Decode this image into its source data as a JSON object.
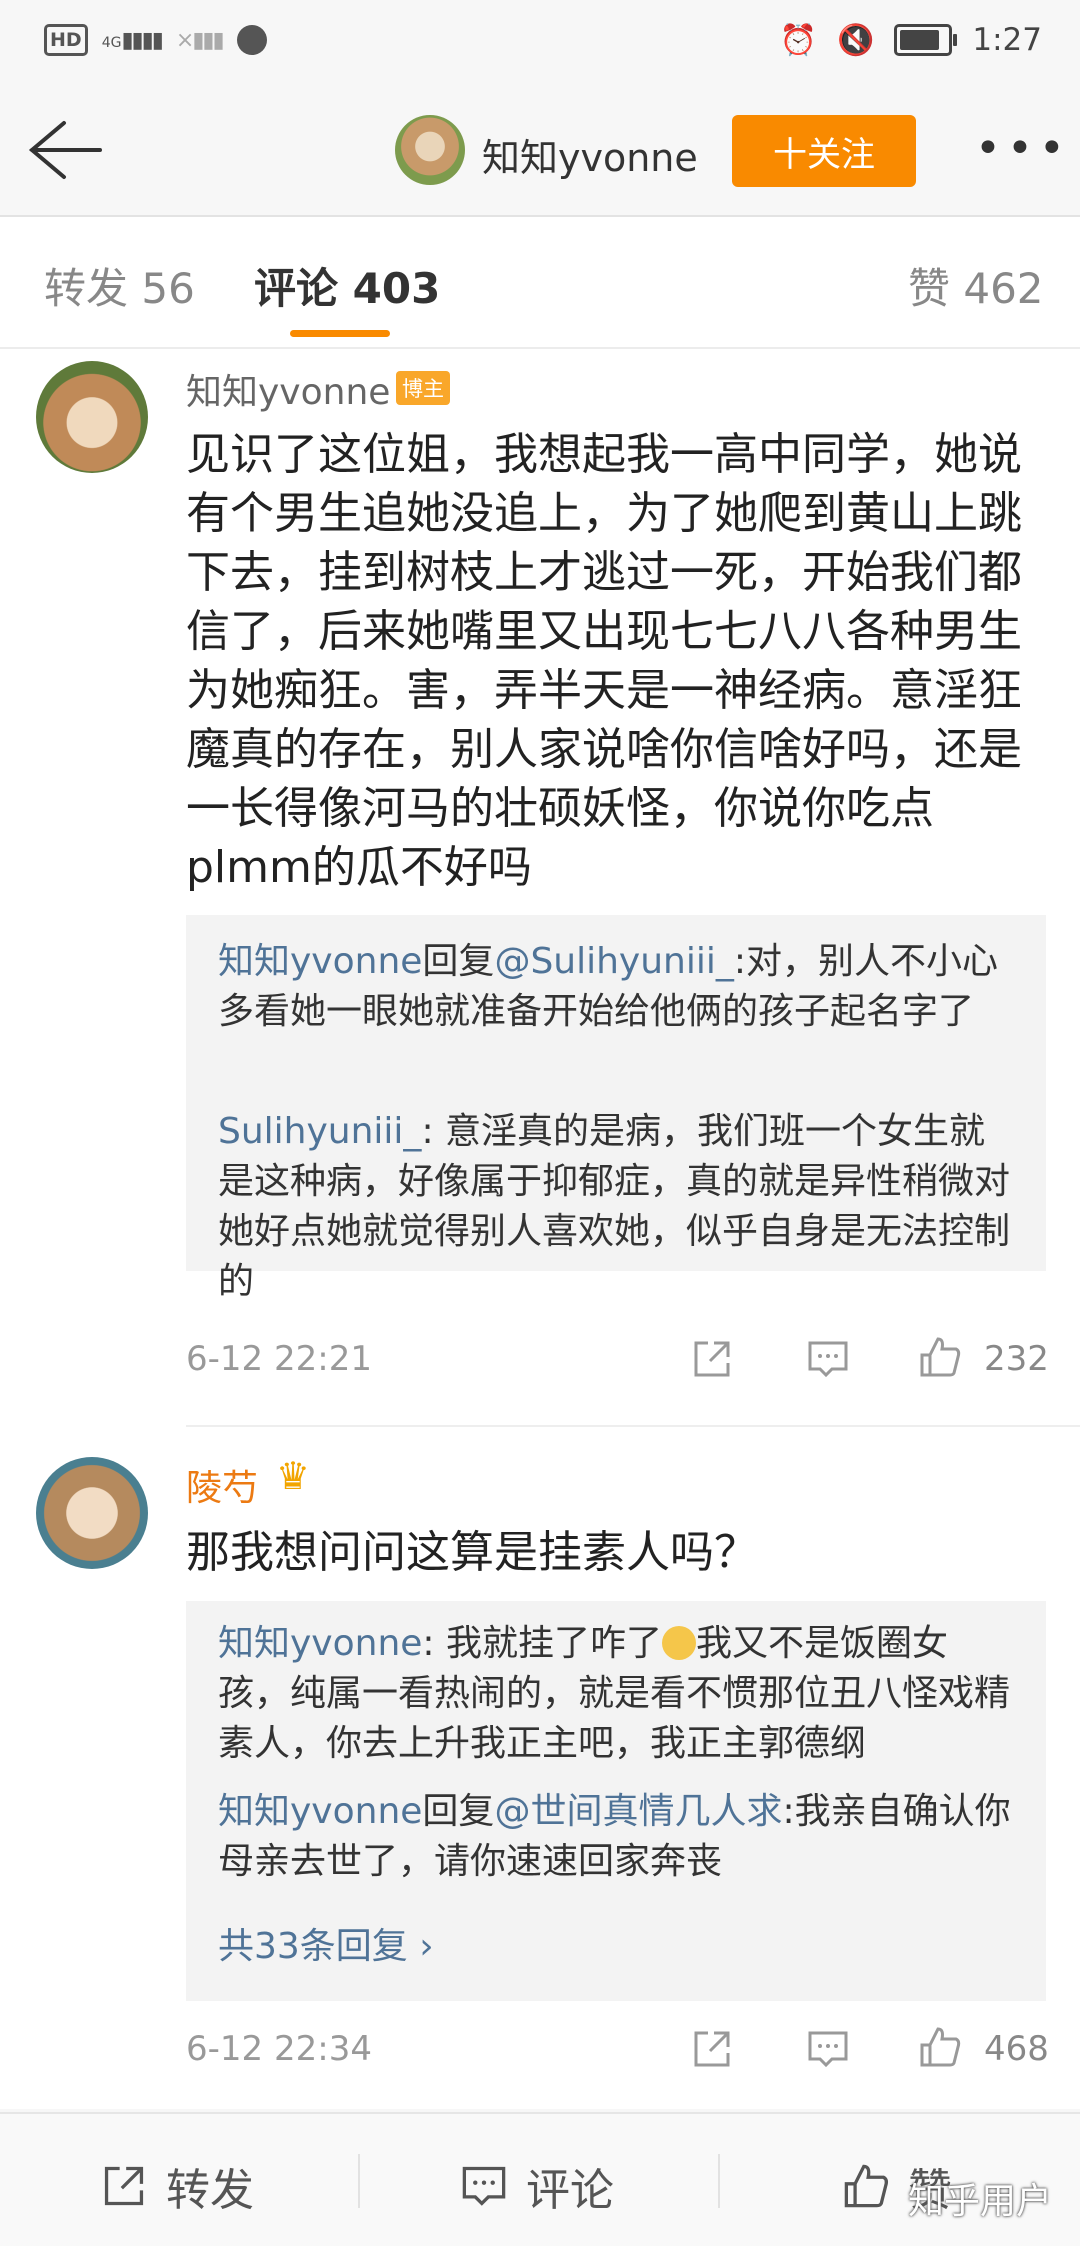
{
  "status_bar": {
    "network": "HD",
    "signal_label": "4G",
    "time": "1:27",
    "battery_level": 0.85
  },
  "nav": {
    "user_name": "知知yvonne",
    "follow_label": "十关注",
    "more_label": "•••"
  },
  "tabs": [
    {
      "label": "转发 56"
    },
    {
      "label": "评论 403"
    },
    {
      "label": "赞 462"
    }
  ],
  "comments": [
    {
      "author": "知知yvonne",
      "badge": "博主",
      "text": "见识了这位姐，我想起我一高中同学，她说有个男生追她没追上，为了她爬到黄山上跳下去，挂到树枝上才逃过一死，开始我们都信了，后来她嘴里又出现七七八八各种男生为她痴狂。害，弄半天是一神经病。意淫狂魔真的存在，别人家说啥你信啥好吗，还是一长得像河马的壮硕妖怪，你说你吃点plmm的瓜不好吗",
      "replies": [
        {
          "user": "知知yvonne",
          "reply_word": "回复",
          "mention": "@Sulihyuniii_",
          "text": ":对，别人不小心多看她一眼她就准备开始给他俩的孩子起名字了"
        },
        {
          "user": "Sulihyuniii_",
          "text": ": 意淫真的是病，我们班一个女生就是这种病，好像属于抑郁症，真的就是异性稍微对她好点她就觉得别人喜欢她，似乎自身是无法控制的"
        }
      ],
      "time": "6-12 22:21",
      "likes": "232"
    },
    {
      "author": "陵芍",
      "text": "那我想问问这算是挂素人吗？",
      "replies": [
        {
          "user": "知知yvonne",
          "text_a": ": 我就挂了咋了",
          "text_b": "我又不是饭圈女孩，纯属一看热闹的，就是看不惯那位丑八怪戏精素人，你去上升我正主吧，我正主郭德纲"
        },
        {
          "user": "知知yvonne",
          "reply_word": "回复",
          "mention": "@世间真情几人求",
          "text": ":我亲自确认你母亲去世了，请你速速回家奔丧"
        }
      ],
      "more_replies": "共33条回复 ›",
      "time": "6-12 22:34",
      "likes": "468"
    }
  ],
  "bottom_bar": {
    "repost": "转发",
    "comment": "评论",
    "like": "赞"
  },
  "watermark": "知乎用户",
  "colors": {
    "accent": "#f98a00",
    "link": "#4f7397",
    "vip_name": "#ec7a12"
  }
}
